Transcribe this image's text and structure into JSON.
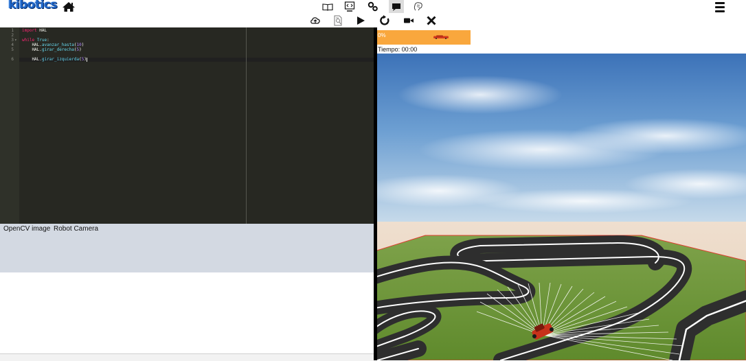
{
  "app": {
    "logo_text": "kibotics",
    "brand_color": "#1e63c4"
  },
  "nav": {
    "home_icon": "home-icon",
    "center_icons": [
      "book-icon",
      "monitor-code-icon",
      "gears-icon",
      "chat-icon",
      "brain-icon"
    ],
    "active_icon": "chat-icon",
    "menu_icon": "hamburger-icon"
  },
  "toolbar": {
    "icons": [
      "cloud-upload-icon",
      "inspect-file-icon",
      "play-icon",
      "reset-icon",
      "camera-icon",
      "close-icon"
    ]
  },
  "editor": {
    "language": "python",
    "lines": [
      {
        "n": "1",
        "code": "import HAL"
      },
      {
        "n": "2",
        "code": ""
      },
      {
        "n": "3",
        "code": "while True:",
        "fold": "▾"
      },
      {
        "n": "4",
        "code": "    HAL.avanzar_hasta(10)"
      },
      {
        "n": "5",
        "code": "    HAL.girar_derecha(5)"
      },
      {
        "n": "6",
        "code": "    HAL.girar_izquierda(5)"
      }
    ],
    "active_line": 6
  },
  "camera_panel": {
    "tabs": [
      "OpenCV image",
      "Robot Camera"
    ]
  },
  "simulation": {
    "progress_text": "0%",
    "progress_value": 0,
    "progress_color": "#f9a73d",
    "timer_text": "Tiempo: 00:00"
  }
}
